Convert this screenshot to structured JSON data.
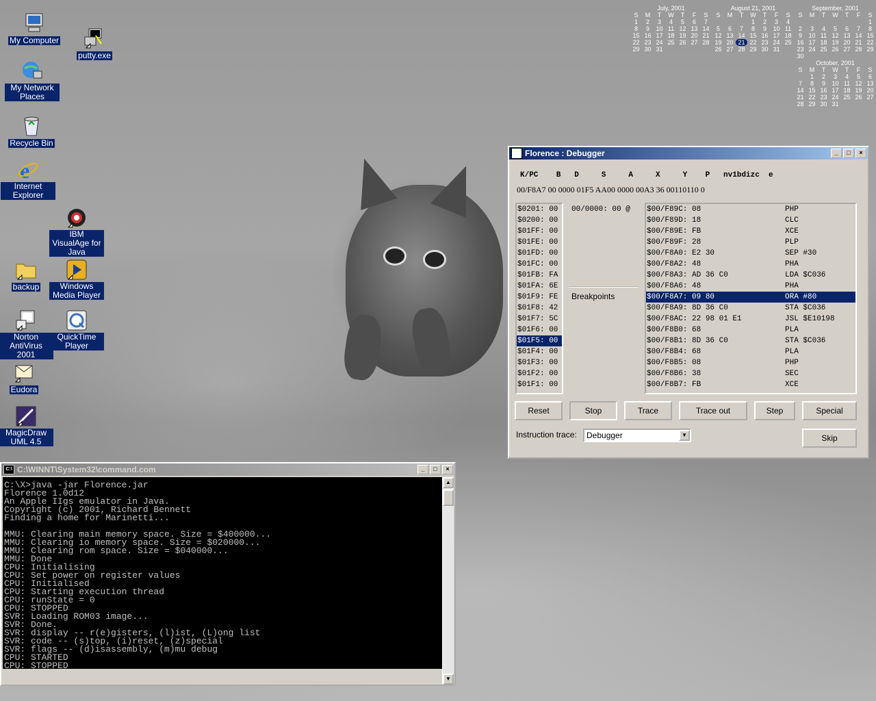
{
  "desktop": {
    "icons": [
      {
        "label": "My Computer"
      },
      {
        "label": "putty.exe"
      },
      {
        "label": "My Network Places"
      },
      {
        "label": "Recycle Bin"
      },
      {
        "label": "Internet Explorer"
      },
      {
        "label": "IBM VisualAge for Java"
      },
      {
        "label": "backup"
      },
      {
        "label": "Windows Media Player"
      },
      {
        "label": "Norton AntiVirus 2001"
      },
      {
        "label": "QuickTime Player"
      },
      {
        "label": "Eudora"
      },
      {
        "label": "MagicDraw UML 4.5"
      }
    ]
  },
  "calendar": {
    "day_header": [
      "S",
      "M",
      "T",
      "W",
      "T",
      "F",
      "S"
    ],
    "months": [
      {
        "title": "July, 2001",
        "days": [
          "1",
          "2",
          "3",
          "4",
          "5",
          "6",
          "7",
          "8",
          "9",
          "10",
          "11",
          "12",
          "13",
          "14",
          "15",
          "16",
          "17",
          "18",
          "19",
          "20",
          "21",
          "22",
          "23",
          "24",
          "25",
          "26",
          "27",
          "28",
          "29",
          "30",
          "31"
        ],
        "start": 0
      },
      {
        "title": "August 21, 2001",
        "days": [
          "1",
          "2",
          "3",
          "4",
          "5",
          "6",
          "7",
          "8",
          "9",
          "10",
          "11",
          "12",
          "13",
          "14",
          "15",
          "16",
          "17",
          "18",
          "19",
          "20",
          "21",
          "22",
          "23",
          "24",
          "25",
          "26",
          "27",
          "28",
          "29",
          "30",
          "31"
        ],
        "start": 3,
        "today": "21"
      },
      {
        "title": "September, 2001",
        "days": [
          "1",
          "2",
          "3",
          "4",
          "5",
          "6",
          "7",
          "8",
          "9",
          "10",
          "11",
          "12",
          "13",
          "14",
          "15",
          "16",
          "17",
          "18",
          "19",
          "20",
          "21",
          "22",
          "23",
          "24",
          "25",
          "26",
          "27",
          "28",
          "29",
          "30"
        ],
        "start": 6
      },
      {
        "title": "October, 2001",
        "days": [
          "1",
          "2",
          "3",
          "4",
          "5",
          "6",
          "7",
          "8",
          "9",
          "10",
          "11",
          "12",
          "13",
          "14",
          "15",
          "16",
          "17",
          "18",
          "19",
          "20",
          "21",
          "22",
          "23",
          "24",
          "25",
          "26",
          "27",
          "28",
          "29",
          "30",
          "31"
        ],
        "start": 1
      }
    ]
  },
  "debugger": {
    "title": "Florence : Debugger",
    "reg_headers": "K/PC    B   D     S     A     X     Y    P   nv1bdizc  e",
    "reg_values": "00/F8A7 00 0000 01F5 AA00 0000 00A3 36 00110110 0",
    "stack": [
      "$0201: 00",
      "$0200: 00",
      "$01FF: 00",
      "$01FE: 00",
      "$01FD: 00",
      "$01FC: 00",
      "$01FB: FA",
      "$01FA: 6E",
      "$01F9: FE",
      "$01F8: 42",
      "$01F7: 5C",
      "$01F6: 00",
      "$01F5: 00",
      "$01F4: 00",
      "$01F3: 00",
      "$01F2: 00",
      "$01F1: 00"
    ],
    "stack_selected": 12,
    "memory_line": "00/0000: 00 @",
    "breakpoints_label": "Breakpoints",
    "disassembly": [
      {
        "addr": "$00/F89C: 08",
        "op": "PHP"
      },
      {
        "addr": "$00/F89D: 18",
        "op": "CLC"
      },
      {
        "addr": "$00/F89E: FB",
        "op": "XCE"
      },
      {
        "addr": "$00/F89F: 28",
        "op": "PLP"
      },
      {
        "addr": "$00/F8A0: E2 30",
        "op": "SEP #30"
      },
      {
        "addr": "$00/F8A2: 48",
        "op": "PHA"
      },
      {
        "addr": "$00/F8A3: AD 36 C0",
        "op": "LDA $C036"
      },
      {
        "addr": "$00/F8A6: 48",
        "op": "PHA"
      },
      {
        "addr": "$00/F8A7: 09 80",
        "op": "ORA #80"
      },
      {
        "addr": "$00/F8A9: 8D 36 C0",
        "op": "STA $C036"
      },
      {
        "addr": "$00/F8AC: 22 98 01 E1",
        "op": "JSL $E10198"
      },
      {
        "addr": "$00/F8B0: 68",
        "op": "PLA"
      },
      {
        "addr": "$00/F8B1: 8D 36 C0",
        "op": "STA $C036"
      },
      {
        "addr": "$00/F8B4: 68",
        "op": "PLA"
      },
      {
        "addr": "$00/F8B5: 08",
        "op": "PHP"
      },
      {
        "addr": "$00/F8B6: 38",
        "op": "SEC"
      },
      {
        "addr": "$00/F8B7: FB",
        "op": "XCE"
      }
    ],
    "disassembly_selected": 8,
    "buttons": {
      "reset": "Reset",
      "stop": "Stop",
      "trace": "Trace",
      "trace_out": "Trace out",
      "step": "Step",
      "special": "Special",
      "skip": "Skip"
    },
    "trace_label": "Instruction trace:",
    "trace_value": "Debugger"
  },
  "console": {
    "title": "C:\\WINNT\\System32\\command.com",
    "lines": [
      "C:\\X>java -jar Florence.jar",
      "Florence 1.0d12",
      "An Apple IIgs emulator in Java.",
      "Copyright (c) 2001, Richard Bennett",
      "Finding a home for Marinetti...",
      "",
      "MMU: Clearing main memory space. Size = $400000...",
      "MMU: Clearing io memory space. Size = $020000...",
      "MMU: Clearing rom space. Size = $040000...",
      "MMU: Done",
      "CPU: Initialising",
      "CPU: Set power on register values",
      "CPU: Initialised",
      "CPU: Starting execution thread",
      "CPU: runState = 0",
      "CPU: STOPPED",
      "SVR: Loading ROM03 image...",
      "SVR: Done.",
      "SVR: display -- r(e)gisters, (l)ist, (L)ong list",
      "SVR: code -- (s)top, (i)reset, (z)special",
      "SVR: flags -- (d)isassembly, (m)mu debug",
      "CPU: STARTED",
      "CPU: STOPPED"
    ]
  }
}
